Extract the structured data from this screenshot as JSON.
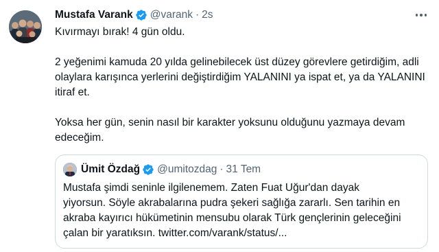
{
  "tweet": {
    "author_name": "Mustafa Varank",
    "handle": "@varank",
    "separator": "·",
    "time": "2s",
    "paragraphs": [
      "Kıvırmayı bırak! 4 gün oldu.",
      "2 yeğenimi kamuda 20 yılda gelinebilecek üst düzey görevlere getirdiğim, adli olaylara karışınca yerlerini değiştirdiğim YALANINI ya ispat et, ya da YALANINI itiraf et.",
      "Yoksa her gün, senin nasıl bir karakter yoksunu olduğunu yazmaya devam edeceğim."
    ]
  },
  "quote": {
    "author_name": "Ümit Özdağ",
    "handle": "@umitozdag",
    "separator": "·",
    "time": "31 Tem",
    "lines": [
      "Mustafa şimdi seninle ilgilenemem. Zaten Fuat Uğur'dan dayak",
      "yiyorsun. Söyle akrabalarına pudra şekeri sağlığa zararlı. Sen tarihin en",
      "akraba kayırıcı hükümetinin mensubu olarak Türk gençlerinin geleceğini",
      "çalan bir yaratıksın. twitter.com/varank/status/..."
    ]
  },
  "icons": {
    "verified": "verified-badge-icon",
    "more": "more-options-icon"
  },
  "colors": {
    "verified_blue": "#1d9bf0",
    "secondary_text": "#536471",
    "border": "#cfd9de",
    "primary_text": "#0f1419"
  }
}
